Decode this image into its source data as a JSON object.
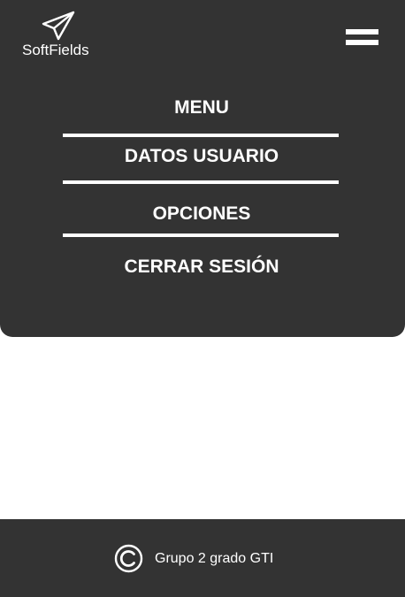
{
  "header": {
    "logo_text": "SoftFields",
    "logo_icon": "paper-plane-icon",
    "menu_toggle_icon": "hamburger-icon"
  },
  "menu": {
    "title": "MENU",
    "items": [
      {
        "label": "DATOS USUARIO"
      },
      {
        "label": "OPCIONES"
      },
      {
        "label": "CERRAR SESIÓN"
      }
    ]
  },
  "footer": {
    "icon": "copyright-icon",
    "text": "Grupo 2 grado GTI"
  },
  "colors": {
    "panel_background": "#333333",
    "page_background": "#ffffff",
    "text": "#ffffff"
  }
}
